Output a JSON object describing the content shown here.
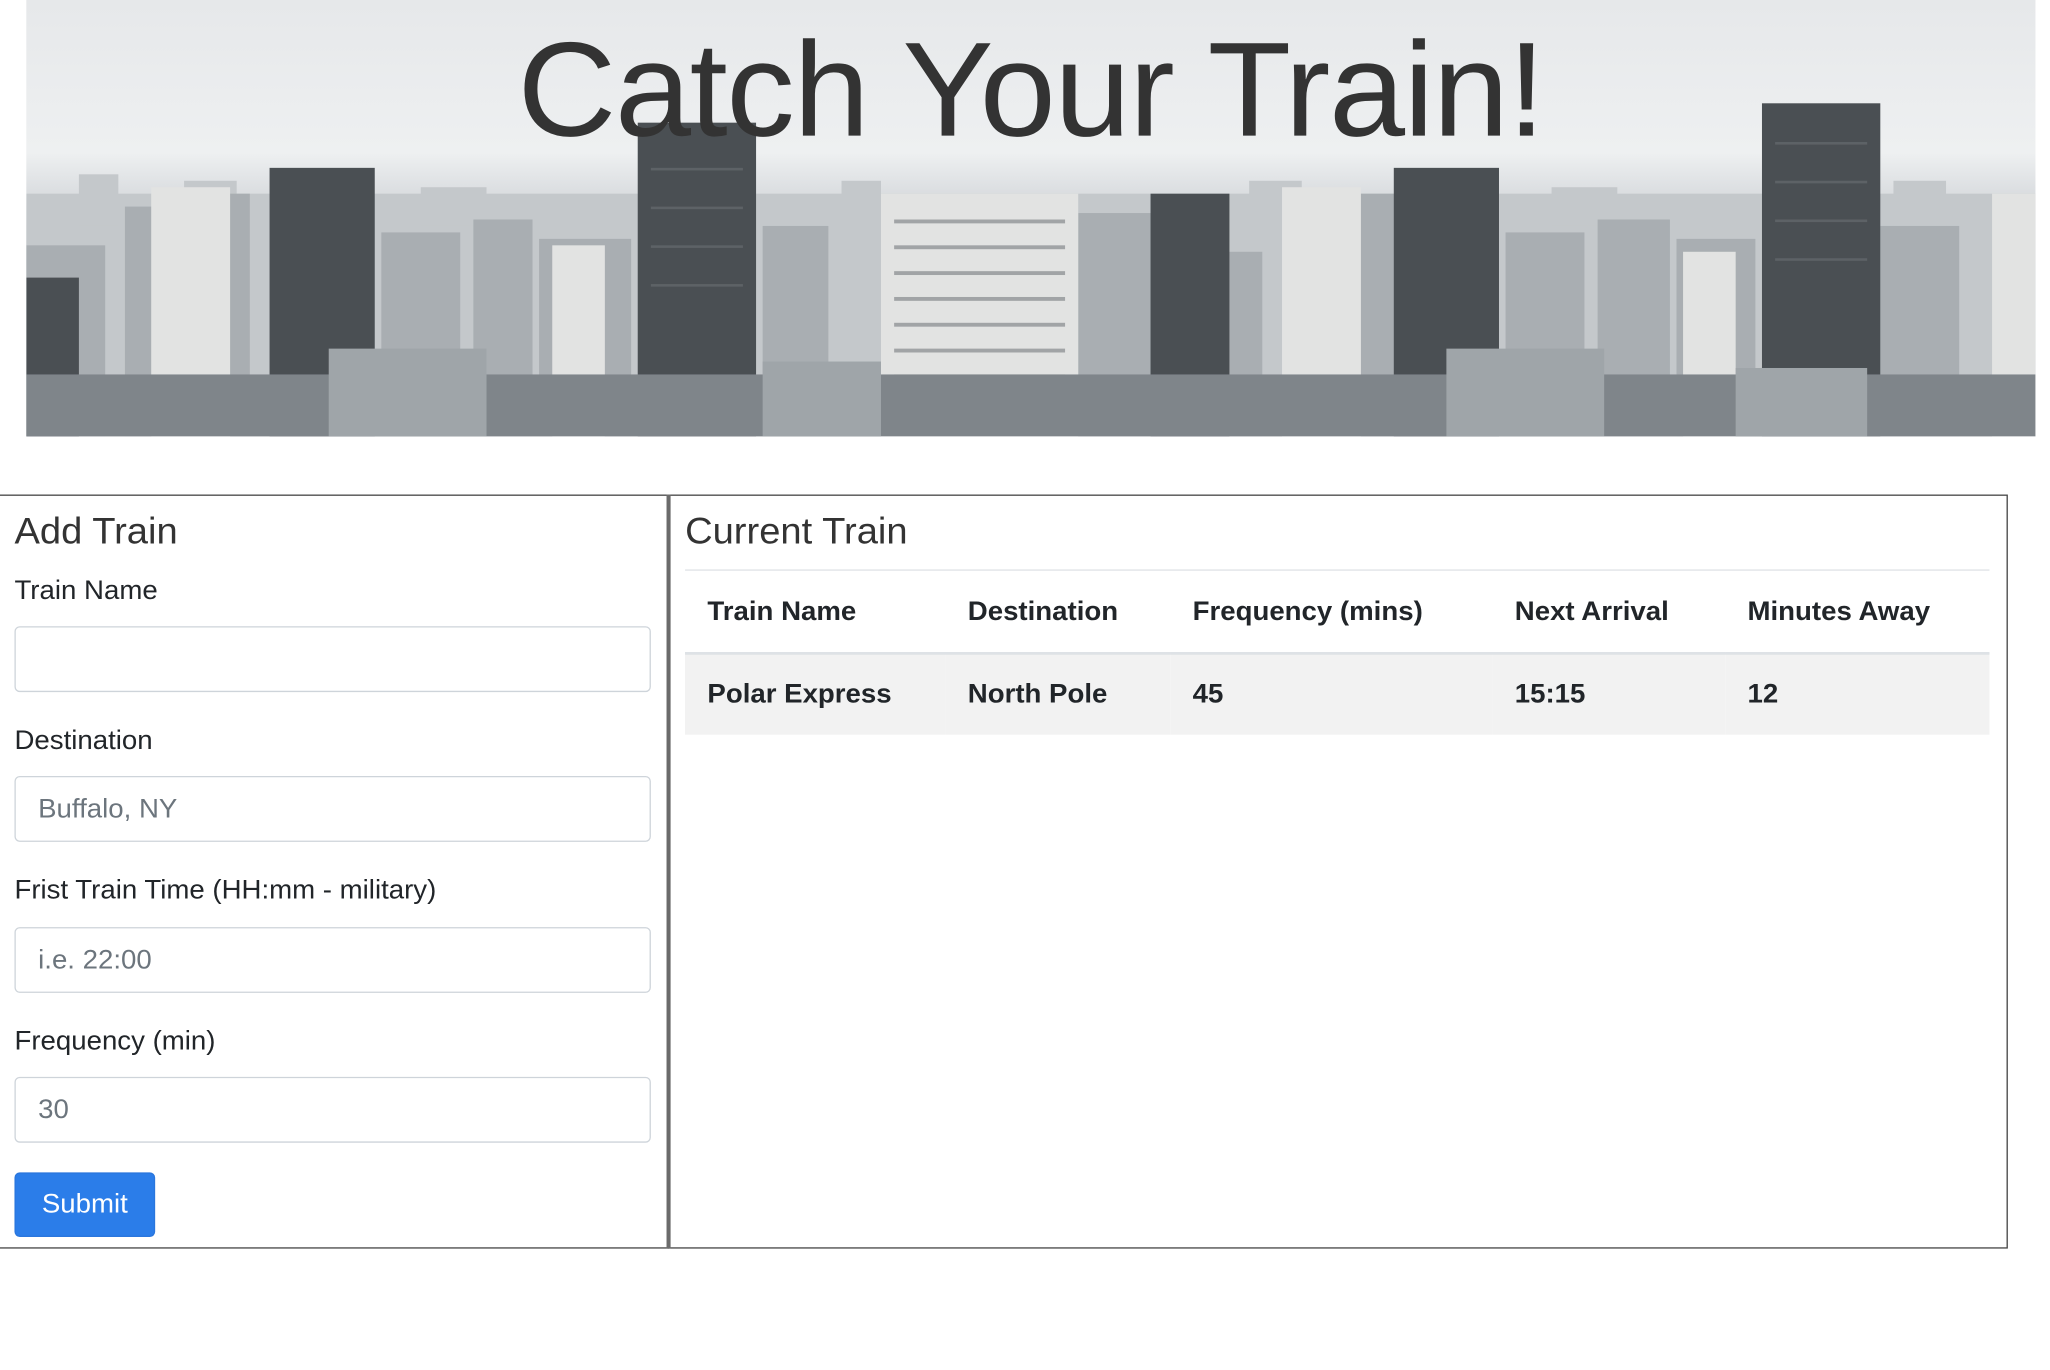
{
  "banner": {
    "title": "Catch Your Train!"
  },
  "add_train": {
    "heading": "Add Train",
    "fields": {
      "train_name": {
        "label": "Train Name",
        "placeholder": "",
        "value": ""
      },
      "destination": {
        "label": "Destination",
        "placeholder": "Buffalo, NY",
        "value": ""
      },
      "first_time": {
        "label": "Frist Train Time (HH:mm - military)",
        "placeholder": "i.e. 22:00",
        "value": ""
      },
      "frequency": {
        "label": "Frequency (min)",
        "placeholder": "30",
        "value": ""
      }
    },
    "submit_label": "Submit"
  },
  "current_train": {
    "heading": "Current Train",
    "columns": [
      "Train Name",
      "Destination",
      "Frequency (mins)",
      "Next Arrival",
      "Minutes Away"
    ],
    "rows": [
      [
        "Polar Express",
        "North Pole",
        "45",
        "15:15",
        "12"
      ]
    ]
  },
  "colors": {
    "primary_button": "#2b7de9",
    "striped_row": "#f2f2f2",
    "title_text": "#333333"
  }
}
